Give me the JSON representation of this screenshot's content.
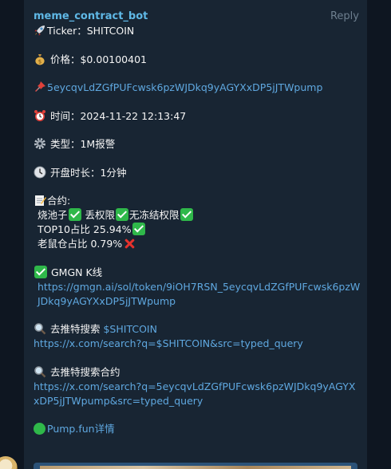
{
  "header": {
    "sender": "meme_contract_bot",
    "reply_label": "Reply"
  },
  "message": {
    "ticker": "Ticker：SHITCOIN",
    "price": "价格：$0.00100401",
    "address": "5eycqvLdZGfPUFcwsk6pzWJDkq9yAGYXxDP5jJTWpump",
    "time": "时间：2024-11-22 12:13:47",
    "type": "类型：1M报警",
    "duration": "开盘时长：1分钟",
    "contract_header": "合约:",
    "contract_line1_a": "烧池子",
    "contract_line1_b": " 丢权限",
    "contract_line1_c": "无冻结权限",
    "top10": "TOP10占比  25.94%",
    "rat": "老鼠仓占比  0.79%",
    "gmgn_label": "GMGN K线",
    "gmgn_url": "https://gmgn.ai/sol/token/9iOH7RSN_5eycqvLdZGfPUFcwsk6pzWJDkq9yAGYXxDP5jJTWpump",
    "search_label": "去推特搜索",
    "search_term": "$SHITCOIN",
    "search_url": "https://x.com/search?q=$SHITCOIN&src=typed_query",
    "search_contract_label": "去推特搜索合约",
    "search_contract_url": "https://x.com/search?q=5eycqvLdZGfPUFcwsk6pzWJDkq9yAGYXxDP5jJTWpump&src=typed_query",
    "pump_label": "Pump.fun详情"
  },
  "colors": {
    "background": "#0e1621",
    "bubble": "#182533",
    "sender": "#5fb8e6",
    "link": "#5fa8e0"
  },
  "icons": [
    "rocket-icon",
    "money-bag-icon",
    "pin-icon",
    "alarm-clock-icon",
    "gear-icon",
    "clock-icon",
    "memo-icon",
    "check-mark-icon",
    "cross-mark-icon",
    "magnifier-icon",
    "green-circle-icon"
  ]
}
